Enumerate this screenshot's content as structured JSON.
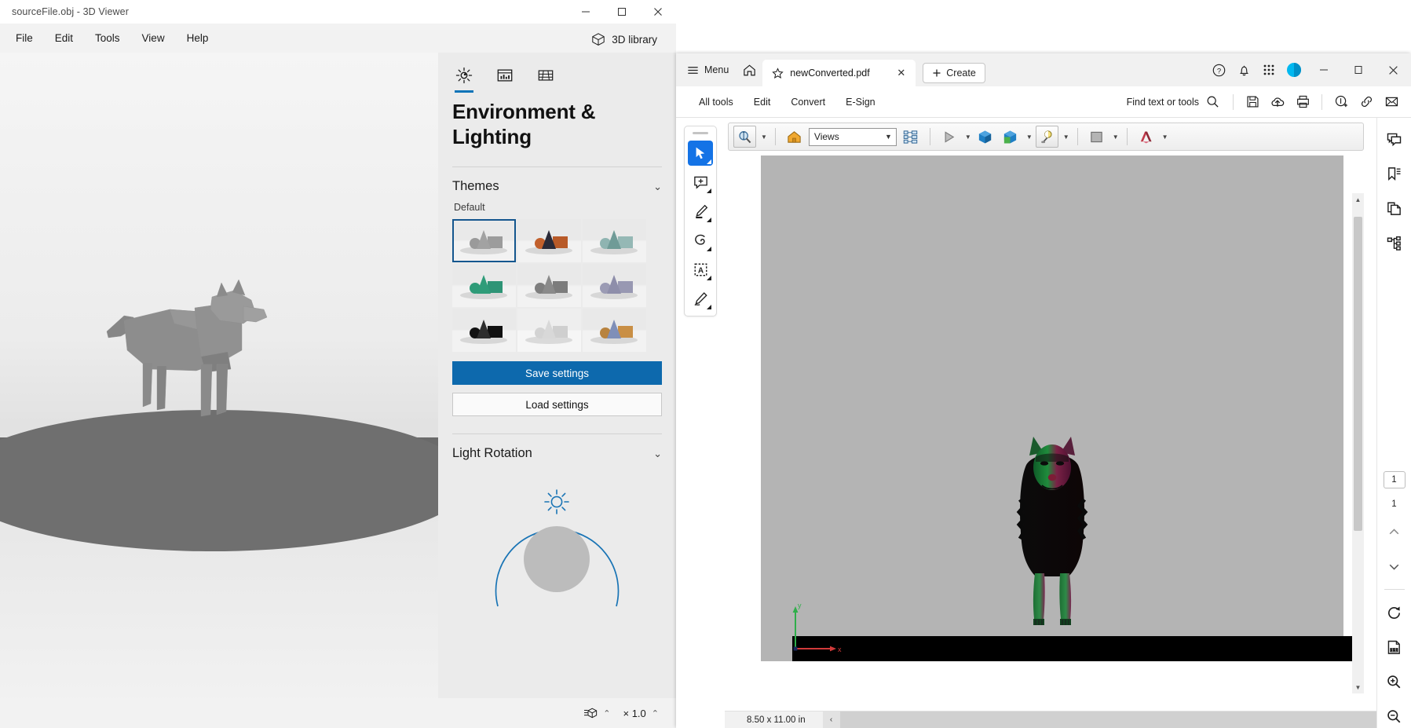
{
  "viewer3d": {
    "window_title": "sourceFile.obj - 3D Viewer",
    "window_controls": {
      "minimize": "─",
      "maximize": "☐",
      "close": "✕"
    },
    "menu": [
      {
        "label": "File"
      },
      {
        "label": "Edit"
      },
      {
        "label": "Tools"
      },
      {
        "label": "View"
      },
      {
        "label": "Help"
      }
    ],
    "library_button": {
      "label": "3D library",
      "icon": "cube-icon"
    },
    "panel": {
      "tabs": [
        {
          "name": "environment-lighting",
          "icon": "sun-icon",
          "active": true
        },
        {
          "name": "statistics",
          "icon": "chart-panel-icon",
          "active": false
        },
        {
          "name": "grid",
          "icon": "grid-icon",
          "active": false
        }
      ],
      "heading": "Environment & Lighting",
      "sections": [
        {
          "title": "Themes",
          "chevron": "⌄"
        },
        {
          "title": "Light Rotation",
          "chevron": "⌄"
        }
      ],
      "themes_group_label": "Default",
      "themes": [
        {
          "name": "theme-gray-light",
          "selected": true,
          "sphere": "#9a9a9a",
          "cone": "#a2a2a2",
          "box": "#9c9c9c",
          "bg_top": "#e9e9e9",
          "bg_bottom": "#f2f2f2"
        },
        {
          "name": "theme-orange",
          "selected": false,
          "sphere": "#c2602c",
          "cone": "#2a2a38",
          "box": "#b85a28",
          "bg_top": "#e9e9e9",
          "bg_bottom": "#f2f2f2"
        },
        {
          "name": "theme-teal-pale",
          "selected": false,
          "sphere": "#8fb4b1",
          "cone": "#6f9b97",
          "box": "#95b8b5",
          "bg_top": "#e9e9e9",
          "bg_bottom": "#f2f2f2"
        },
        {
          "name": "theme-green",
          "selected": false,
          "sphere": "#2e9b78",
          "cone": "#2f9c79",
          "box": "#2e9476",
          "bg_top": "#e9e9e9",
          "bg_bottom": "#f2f2f2"
        },
        {
          "name": "theme-gray-mid",
          "selected": false,
          "sphere": "#7e7e7e",
          "cone": "#8a8a8a",
          "box": "#7c7c7c",
          "bg_top": "#e9e9e9",
          "bg_bottom": "#f2f2f2"
        },
        {
          "name": "theme-lavender",
          "selected": false,
          "sphere": "#9b9bb4",
          "cone": "#8e8eaa",
          "box": "#9898b2",
          "bg_top": "#e9e9e9",
          "bg_bottom": "#f2f2f2"
        },
        {
          "name": "theme-black",
          "selected": false,
          "sphere": "#121212",
          "cone": "#2d2d2d",
          "box": "#101010",
          "bg_top": "#e9e9e9",
          "bg_bottom": "#f2f2f2"
        },
        {
          "name": "theme-white",
          "selected": false,
          "sphere": "#d3d3d3",
          "cone": "#d8d8d8",
          "box": "#cfcfcf",
          "bg_top": "#eeeeee",
          "bg_bottom": "#f6f6f6"
        },
        {
          "name": "theme-colorful",
          "selected": false,
          "sphere": "#b8833f",
          "cone": "#7f8fb8",
          "box": "#c98f45",
          "bg_top": "#e9e9e9",
          "bg_bottom": "#f2f2f2"
        }
      ],
      "save_button": "Save settings",
      "load_button": "Load settings",
      "light_rotation": {
        "dial_icon": "sun-icon",
        "accent": "#0d74b8"
      }
    },
    "statusbar": {
      "model_icon": "model-detail-icon",
      "model_chevron": "⌃",
      "zoom_label": "× 1.0",
      "zoom_chevron": "⌃"
    },
    "scene": {
      "model": "low-poly dog standing on circular pedestal",
      "model_color": "#8e8e8e",
      "pedestal_color": "#6f6f6f"
    }
  },
  "acrobat": {
    "menu_label": "Menu",
    "menu_icon": "hamburger-icon",
    "home_icon": "home-icon",
    "tab": {
      "title": "newConverted.pdf",
      "star_icon": "star-icon",
      "close": "✕"
    },
    "create_button": {
      "label": "Create",
      "icon": "plus-icon"
    },
    "header_icons": [
      {
        "name": "help-icon",
        "glyph": "?"
      },
      {
        "name": "notification-bell-icon",
        "glyph": "bell"
      },
      {
        "name": "app-grid-icon",
        "glyph": "grid"
      },
      {
        "name": "account-avatar",
        "glyph": "avatar"
      }
    ],
    "window_controls": {
      "minimize": "─",
      "maximize": "☐",
      "close": "✕"
    },
    "toolbar": {
      "items": [
        {
          "label": "All tools"
        },
        {
          "label": "Edit"
        },
        {
          "label": "Convert"
        },
        {
          "label": "E-Sign"
        }
      ],
      "find_placeholder": "Find text or tools",
      "find_icon": "search-icon",
      "right_icons": [
        {
          "name": "save-icon"
        },
        {
          "name": "upload-cloud-icon"
        },
        {
          "name": "print-icon"
        },
        {
          "name": "add-stamp-icon"
        },
        {
          "name": "share-link-icon"
        },
        {
          "name": "email-icon"
        }
      ]
    },
    "left_rail": [
      {
        "name": "select-tool",
        "icon": "cursor-arrow-icon",
        "active": true
      },
      {
        "name": "comment-tool",
        "icon": "add-comment-icon",
        "active": false
      },
      {
        "name": "highlight-tool",
        "icon": "highlighter-icon",
        "active": false
      },
      {
        "name": "draw-tool",
        "icon": "lasso-icon",
        "active": false
      },
      {
        "name": "text-edit-tool",
        "icon": "select-text-icon",
        "active": false
      },
      {
        "name": "sign-tool",
        "icon": "signature-pen-icon",
        "active": false
      }
    ],
    "pdf_toolbar": {
      "rotate_tool_icon": "rotate-3d-icon",
      "home_view_icon": "home-view-icon",
      "views_select": {
        "value": "Views",
        "arrow": "⌄"
      },
      "model_tree_icon": "model-tree-icon",
      "play_icon": "play-animation-icon",
      "part_icon": "part-render-icon",
      "cross_section_icon": "cross-section-icon",
      "lighting_icon": "lighting-icon",
      "background_icon": "background-color-icon",
      "render_mode_icon": "render-mode-icon"
    },
    "page_view": {
      "model": "low-poly dog front view, dark silhouette with green and magenta lighting",
      "background_color": "#b4b4b4",
      "ground_color": "#000000",
      "axis": {
        "x_label": "x",
        "x_color": "#d13a3a",
        "y_label": "y",
        "y_color": "#2fae4a"
      }
    },
    "right_rail": {
      "top_icons": [
        {
          "name": "comments-panel-icon"
        },
        {
          "name": "bookmarks-panel-icon"
        },
        {
          "name": "page-thumbnails-icon"
        },
        {
          "name": "layers-panel-icon"
        }
      ],
      "page_number": "1",
      "page_total": "1",
      "prev_page_icon": "chevron-up-icon",
      "next_page_icon": "chevron-down-icon",
      "bottom_icons": [
        {
          "name": "rotate-page-icon"
        },
        {
          "name": "actual-size-icon"
        },
        {
          "name": "zoom-in-icon"
        },
        {
          "name": "zoom-out-icon"
        }
      ]
    },
    "statusbar": {
      "page_size": "8.50 x 11.00 in",
      "collapse_arrow": "‹"
    }
  }
}
